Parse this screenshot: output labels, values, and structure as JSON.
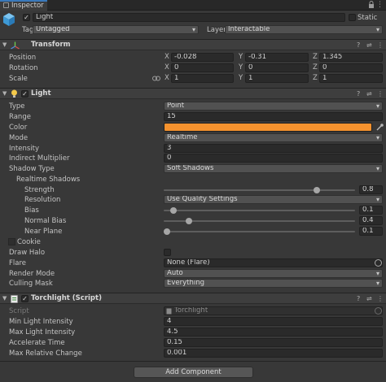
{
  "tab": {
    "label": "Inspector"
  },
  "object": {
    "name": "Light",
    "static_label": "Static",
    "tag_label": "Tag",
    "tag_value": "Untagged",
    "layer_label": "Layer",
    "layer_value": "Interactable"
  },
  "transform": {
    "title": "Transform",
    "rows": [
      {
        "label": "Position",
        "x": "-0.028",
        "y": "-0.31",
        "z": "1.345"
      },
      {
        "label": "Rotation",
        "x": "0",
        "y": "0",
        "z": "0"
      },
      {
        "label": "Scale",
        "x": "1",
        "y": "1",
        "z": "1"
      }
    ],
    "axes": [
      "X",
      "Y",
      "Z"
    ]
  },
  "light": {
    "title": "Light",
    "type_label": "Type",
    "type_value": "Point",
    "range_label": "Range",
    "range_value": "15",
    "color_label": "Color",
    "color_value": "#f5922e",
    "mode_label": "Mode",
    "mode_value": "Realtime",
    "intensity_label": "Intensity",
    "intensity_value": "3",
    "indirect_label": "Indirect Multiplier",
    "indirect_value": "0",
    "shadow_type_label": "Shadow Type",
    "shadow_type_value": "Soft Shadows",
    "realtime_shadows_label": "Realtime Shadows",
    "strength_label": "Strength",
    "strength_value": "0.8",
    "strength_fraction": 0.8,
    "resolution_label": "Resolution",
    "resolution_value": "Use Quality Settings",
    "bias_label": "Bias",
    "bias_value": "0.1",
    "bias_fraction": 0.05,
    "normal_bias_label": "Normal Bias",
    "normal_bias_value": "0.4",
    "normal_bias_fraction": 0.13,
    "near_plane_label": "Near Plane",
    "near_plane_value": "0.1",
    "near_plane_fraction": 0.0,
    "cookie_label": "Cookie",
    "draw_halo_label": "Draw Halo",
    "flare_label": "Flare",
    "flare_value": "None (Flare)",
    "render_mode_label": "Render Mode",
    "render_mode_value": "Auto",
    "culling_mask_label": "Culling Mask",
    "culling_mask_value": "Everything"
  },
  "torchlight": {
    "title": "Torchlight (Script)",
    "script_label": "Script",
    "script_value": "Torchlight",
    "min_label": "Min Light Intensity",
    "min_value": "4",
    "max_label": "Max Light Intensity",
    "max_value": "4.5",
    "accel_label": "Accelerate Time",
    "accel_value": "0.15",
    "maxrel_label": "Max Relative Change",
    "maxrel_value": "0.001"
  },
  "add_component_label": "Add Component"
}
